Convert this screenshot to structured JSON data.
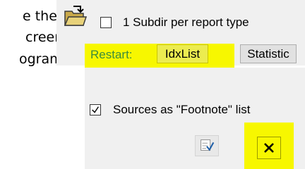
{
  "doc_text": {
    "line1": "e the",
    "line2": "creen",
    "line3": "ogram"
  },
  "options": {
    "subdir_label": "1 Subdir per report type",
    "subdir_checked": false,
    "footnote_label": "Sources as \"Footnote\" list",
    "footnote_checked": true
  },
  "restart": {
    "label": "Restart:",
    "idxlist_button": "IdxList",
    "statistic_button": "Statistic"
  },
  "icons": {
    "folder": "open-folder-icon",
    "apply": "check-apply-icon",
    "close": "close-x-icon"
  },
  "colors": {
    "highlight": "#f7f700",
    "restart_label": "#3c8c3c",
    "panel_bg": "#f0f0f0"
  }
}
